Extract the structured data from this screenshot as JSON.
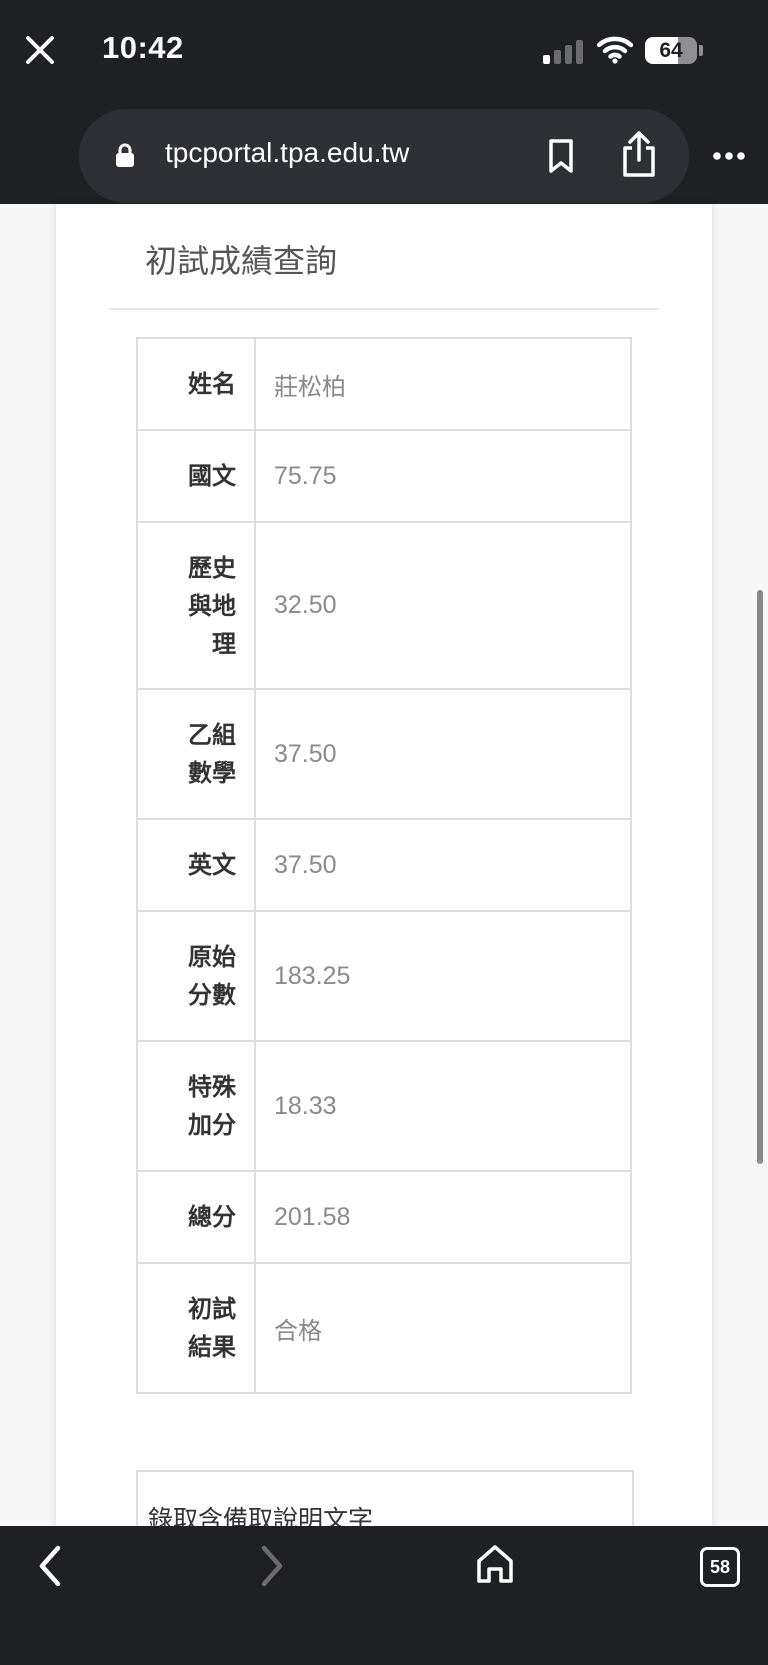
{
  "status_bar": {
    "time": "10:42",
    "battery": "64",
    "battery_level_percent": 64,
    "signal_bars_active": 1,
    "icons": [
      "signal-icon",
      "wifi-icon",
      "battery-icon"
    ]
  },
  "browser": {
    "url": "tpcportal.tpa.edu.tw",
    "icons": [
      "close-icon",
      "lock-icon",
      "bookmark-icon",
      "share-icon",
      "more-icon"
    ],
    "tab_count": "58"
  },
  "page": {
    "title": "初試成績查詢",
    "rows": [
      {
        "label": "姓名",
        "value": "莊松柏"
      },
      {
        "label": "國文",
        "value": "75.75"
      },
      {
        "label": "歷史與地理",
        "value": "32.50"
      },
      {
        "label": "乙組數學",
        "value": "37.50"
      },
      {
        "label": "英文",
        "value": "37.50"
      },
      {
        "label": "原始分數",
        "value": "183.25"
      },
      {
        "label": "特殊加分",
        "value": "18.33"
      },
      {
        "label": "總分",
        "value": "201.58"
      },
      {
        "label": "初試結果",
        "value": "合格"
      }
    ],
    "note_title": "錄取含備取說明文字"
  },
  "bottom_bar": {
    "icons": [
      "back-icon",
      "forward-icon",
      "home-icon",
      "tabs-icon"
    ]
  },
  "colors": {
    "chrome_dark": "#1f2024",
    "url_pill": "#2f3035",
    "table_border": "#dddddd",
    "value_text": "#8a8a8a"
  }
}
